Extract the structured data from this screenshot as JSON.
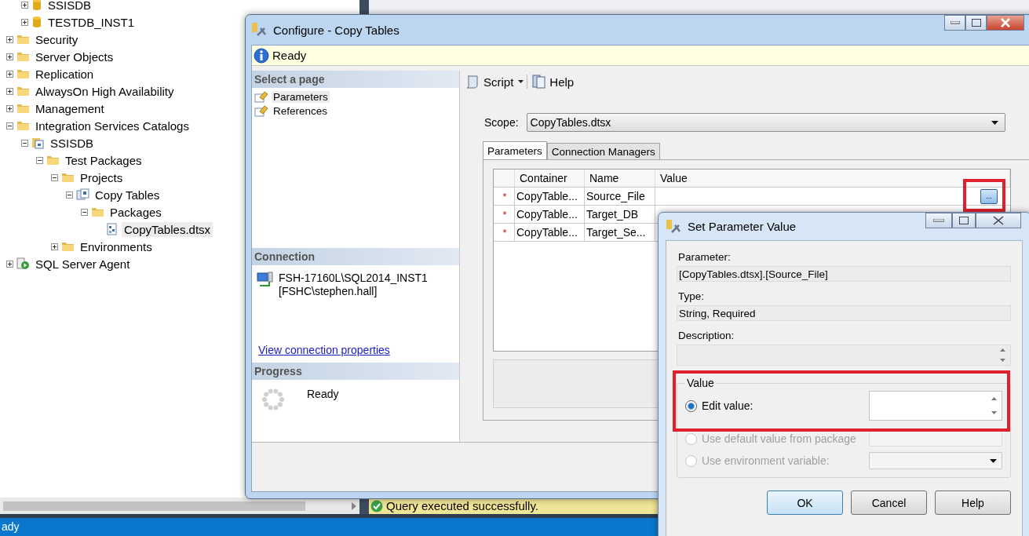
{
  "explorer": {
    "scrolled_children": [
      {
        "label": "SSISDB",
        "kind": "database",
        "expanded": false,
        "selected": false
      },
      {
        "label": "TESTDB_INST1",
        "kind": "database",
        "expanded": false,
        "selected": false
      }
    ],
    "tree": [
      {
        "label": "Security",
        "kind": "folder",
        "expanded": false,
        "selected": false
      },
      {
        "label": "Server Objects",
        "kind": "folder",
        "expanded": false,
        "selected": false
      },
      {
        "label": "Replication",
        "kind": "folder",
        "expanded": false,
        "selected": false
      },
      {
        "label": "AlwaysOn High Availability",
        "kind": "folder",
        "expanded": false,
        "selected": false
      },
      {
        "label": "Management",
        "kind": "folder",
        "expanded": false,
        "selected": false
      },
      {
        "label": "Integration Services Catalogs",
        "kind": "folder",
        "expanded": true,
        "selected": false,
        "children": [
          {
            "label": "SSISDB",
            "kind": "catalog",
            "expanded": true,
            "selected": false,
            "children": [
              {
                "label": "Test Packages",
                "kind": "folder",
                "expanded": true,
                "selected": false,
                "children": [
                  {
                    "label": "Projects",
                    "kind": "folder",
                    "expanded": true,
                    "selected": false,
                    "children": [
                      {
                        "label": "Copy Tables",
                        "kind": "project",
                        "expanded": true,
                        "selected": false,
                        "children": [
                          {
                            "label": "Packages",
                            "kind": "folder",
                            "expanded": true,
                            "selected": false,
                            "children": [
                              {
                                "label": "CopyTables.dtsx",
                                "kind": "package",
                                "selected": true
                              }
                            ]
                          }
                        ]
                      }
                    ]
                  },
                  {
                    "label": "Environments",
                    "kind": "folder",
                    "expanded": false,
                    "selected": false
                  }
                ]
              }
            ]
          }
        ]
      },
      {
        "label": "SQL Server Agent",
        "kind": "agent",
        "expanded": false,
        "selected": false
      }
    ]
  },
  "status": {
    "message": "Query executed successfully."
  },
  "status_bar": {
    "text": "ady"
  },
  "configure_dialog": {
    "title": "Configure - Copy Tables",
    "message": "Ready",
    "select_page": {
      "heading": "Select a page",
      "items": [
        {
          "label": "Parameters",
          "selected": true
        },
        {
          "label": "References",
          "selected": false
        }
      ]
    },
    "connection": {
      "heading": "Connection",
      "server": "FSH-17160L\\SQL2014_INST1",
      "user": "[FSHC\\stephen.hall]",
      "link": "View connection properties"
    },
    "progress": {
      "heading": "Progress",
      "status": "Ready"
    },
    "toolbar": [
      {
        "kind": "script",
        "label": "Script"
      },
      {
        "kind": "help",
        "label": "Help"
      }
    ],
    "scope": {
      "label": "Scope:",
      "value": "CopyTables.dtsx"
    },
    "tabs": [
      {
        "label": "Parameters",
        "selected": true
      },
      {
        "label": "Connection Managers",
        "selected": false
      }
    ],
    "grid": {
      "columns": [
        "Container",
        "Name",
        "Value"
      ],
      "rows": [
        {
          "marker": "*",
          "container": "CopyTable...",
          "name": "Source_File",
          "browse": "...",
          "highlighted": true
        },
        {
          "marker": "*",
          "container": "CopyTable...",
          "name": "Target_DB"
        },
        {
          "marker": "*",
          "container": "CopyTable...",
          "name": "Target_Se..."
        }
      ]
    }
  },
  "parameter_dialog": {
    "title": "Set Parameter Value",
    "fields": [
      {
        "label": "Parameter:",
        "value": "[CopyTables.dtsx].[Source_File]"
      },
      {
        "label": "Type:",
        "value": "String, Required"
      }
    ],
    "description_label": "Description:",
    "value_group": {
      "title": "Value",
      "highlighted": true,
      "options": [
        {
          "label": "Edit value:",
          "selected": true,
          "disabled": false,
          "kind": "text"
        },
        {
          "label": "Use default value from package",
          "selected": false,
          "disabled": true,
          "kind": "text"
        },
        {
          "label": "Use environment variable:",
          "selected": false,
          "disabled": true,
          "kind": "select"
        }
      ]
    },
    "buttons": [
      {
        "label": "OK",
        "default": true
      },
      {
        "label": "Cancel",
        "default": false
      },
      {
        "label": "Help",
        "default": false
      }
    ]
  }
}
